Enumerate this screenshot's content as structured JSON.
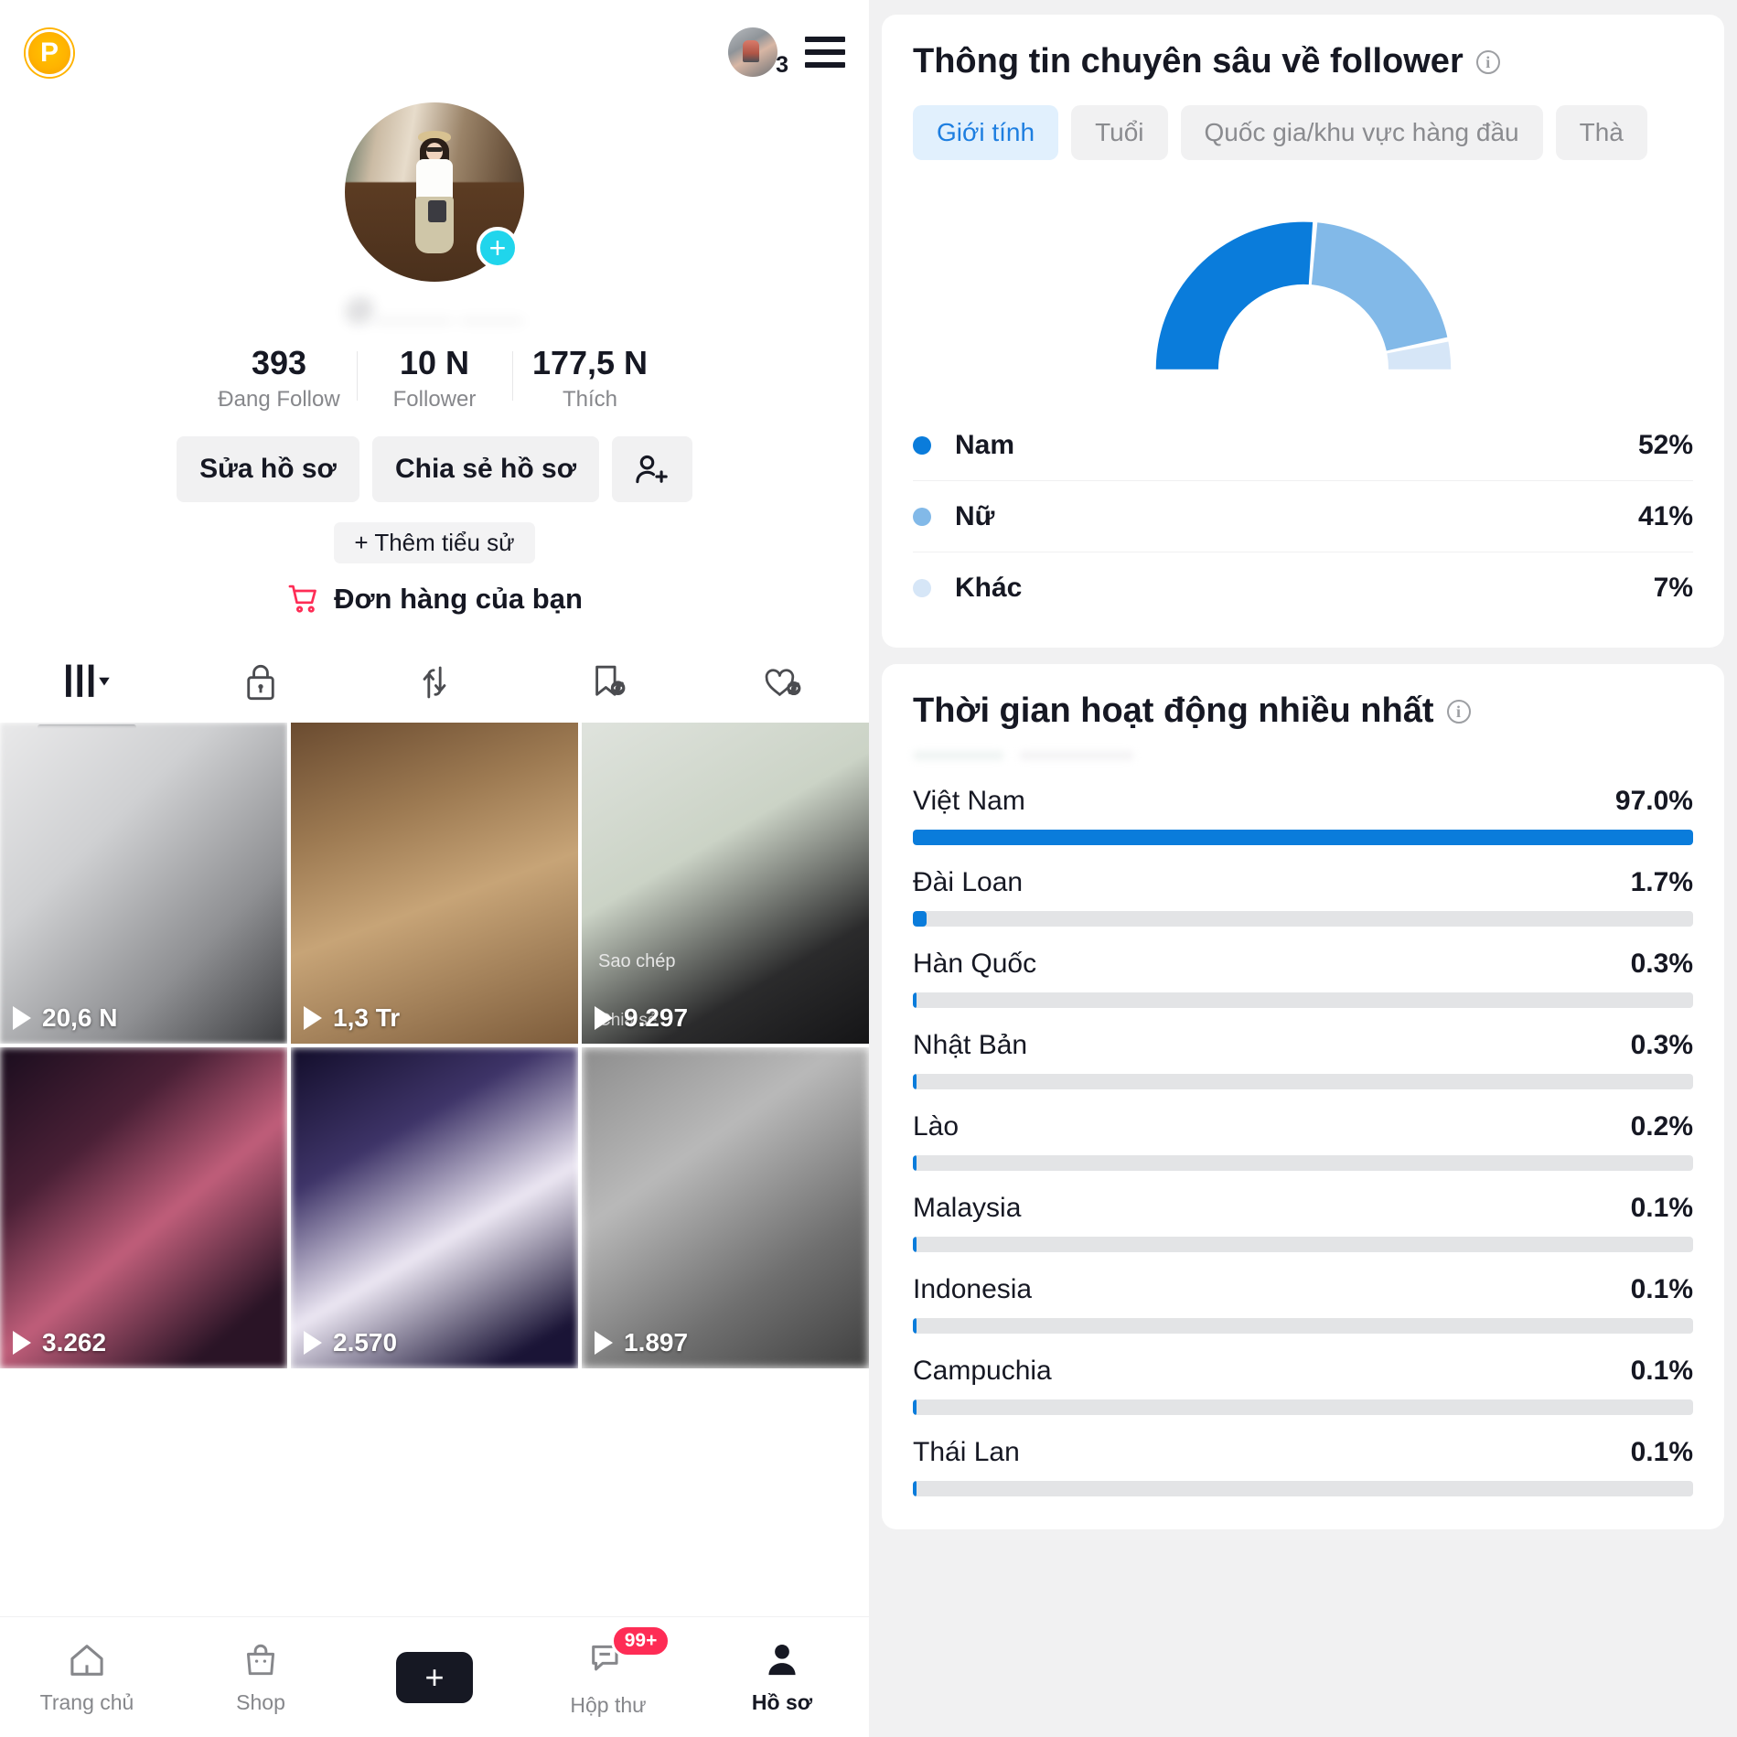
{
  "profile": {
    "app_badge": "P",
    "avatar_notification_count": "3",
    "username_blurred": "@_____ ____",
    "stats": [
      {
        "value": "393",
        "label": "Đang Follow"
      },
      {
        "value": "10 N",
        "label": "Follower"
      },
      {
        "value": "177,5 N",
        "label": "Thích"
      }
    ],
    "buttons": {
      "edit_profile": "Sửa hồ sơ",
      "share_profile": "Chia sẻ hồ sơ",
      "add_friend_icon": "add-person-icon"
    },
    "add_bio": "+ Thêm tiểu sử",
    "orders": "Đơn hàng của bạn",
    "orders_icon": "shopping-cart-icon",
    "tabs": [
      {
        "icon": "posts-grid-icon",
        "active": true
      },
      {
        "icon": "lock-private-icon",
        "active": false
      },
      {
        "icon": "repost-arrows-icon",
        "active": false
      },
      {
        "icon": "bookmark-hidden-icon",
        "active": false
      },
      {
        "icon": "heart-hidden-icon",
        "active": false
      }
    ],
    "videos": [
      {
        "views": "20,6 N"
      },
      {
        "views": "1,3 Tr"
      },
      {
        "views": "9.297"
      },
      {
        "views": "3.262"
      },
      {
        "views": "2.570"
      },
      {
        "views": "1.897"
      }
    ],
    "video3_overlay": {
      "line1": "Sao chép",
      "line2": "Chia sẻ"
    },
    "bottom_nav": [
      {
        "label": "Trang chủ",
        "icon": "home-icon",
        "active": false
      },
      {
        "label": "Shop",
        "icon": "shop-bag-icon",
        "active": false
      },
      {
        "label": "",
        "icon": "create-plus-icon",
        "active": false
      },
      {
        "label": "Hộp thư",
        "icon": "inbox-message-icon",
        "active": false,
        "badge": "99+"
      },
      {
        "label": "Hồ sơ",
        "icon": "profile-person-icon",
        "active": true
      }
    ]
  },
  "analytics": {
    "follower_card": {
      "title": "Thông tin chuyên sâu về follower",
      "info_icon": "info-icon",
      "chips": [
        {
          "label": "Giới tính",
          "active": true
        },
        {
          "label": "Tuổi",
          "active": false
        },
        {
          "label": "Quốc gia/khu vực hàng đầu",
          "active": false
        },
        {
          "label": "Thà",
          "active": false
        }
      ]
    },
    "activity_card": {
      "title": "Thời gian hoạt động nhiều nhất",
      "info_icon": "info-icon"
    }
  },
  "chart_data": [
    {
      "type": "pie",
      "title": "Giới tính",
      "subtype": "半 donut gauge",
      "legend_position": "below",
      "labels": [
        "Nam",
        "Nữ",
        "Khác"
      ],
      "values": [
        52,
        41,
        7
      ],
      "display_values": [
        "52%",
        "41%",
        "7%"
      ],
      "colors": [
        "#0a7cdb",
        "#82b9e8",
        "#d6e6f7"
      ]
    },
    {
      "type": "bar",
      "orientation": "horizontal",
      "title": "Thời gian hoạt động nhiều nhất",
      "xlabel": "",
      "ylabel": "",
      "xlim": [
        0,
        100
      ],
      "grid": false,
      "bar_color": "#0a7cdb",
      "track_color": "#e3e4e6",
      "categories": [
        "Việt Nam",
        "Đài Loan",
        "Hàn Quốc",
        "Nhật Bản",
        "Lào",
        "Malaysia",
        "Indonesia",
        "Campuchia",
        "Thái Lan"
      ],
      "values": [
        97.0,
        1.7,
        0.3,
        0.3,
        0.2,
        0.1,
        0.1,
        0.1,
        0.1
      ],
      "display_values": [
        "97.0%",
        "1.7%",
        "0.3%",
        "0.3%",
        "0.2%",
        "0.1%",
        "0.1%",
        "0.1%",
        "0.1%"
      ]
    }
  ]
}
